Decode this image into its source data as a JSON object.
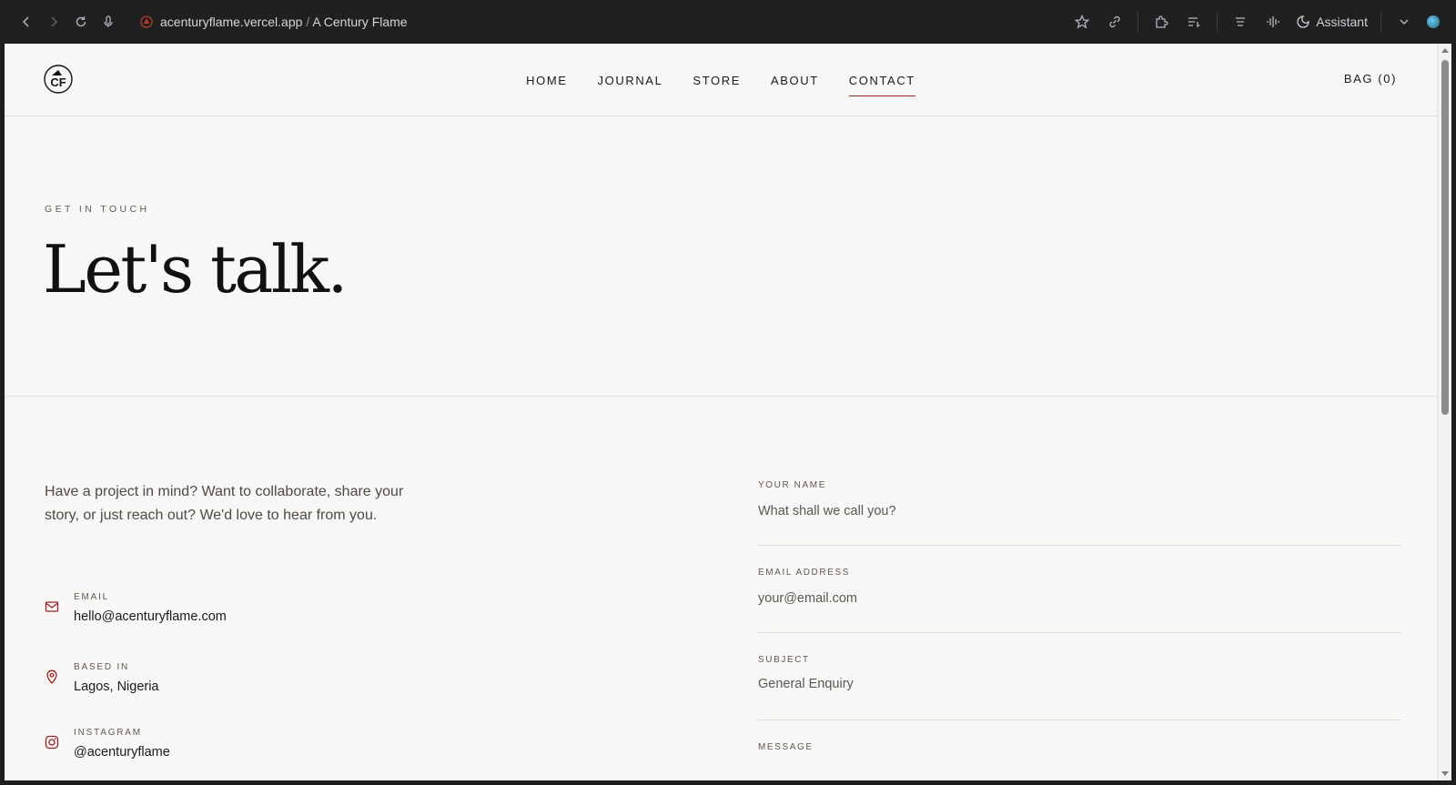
{
  "browser": {
    "url_domain": "acenturyflame.vercel.app",
    "url_separator": "/",
    "page_title": "A Century Flame",
    "assistant_label": "Assistant"
  },
  "header": {
    "logo_text": "CF",
    "nav": [
      {
        "label": "HOME",
        "active": false
      },
      {
        "label": "JOURNAL",
        "active": false
      },
      {
        "label": "STORE",
        "active": false
      },
      {
        "label": "ABOUT",
        "active": false
      },
      {
        "label": "CONTACT",
        "active": true
      }
    ],
    "bag_label": "BAG (0)"
  },
  "hero": {
    "eyebrow": "GET IN TOUCH",
    "headline": "Let's talk."
  },
  "contact": {
    "intro": "Have a project in mind? Want to collaborate, share your story, or just reach out? We'd love to hear from you.",
    "email_label": "EMAIL",
    "email_value": "hello@acenturyflame.com",
    "location_label": "BASED IN",
    "location_value": "Lagos, Nigeria",
    "instagram_label": "INSTAGRAM",
    "instagram_value": "@acenturyflame"
  },
  "form": {
    "name_label": "YOUR NAME",
    "name_placeholder": "What shall we call you?",
    "email_label": "EMAIL ADDRESS",
    "email_placeholder": "your@email.com",
    "subject_label": "SUBJECT",
    "subject_value": "General Enquiry",
    "message_label": "MESSAGE"
  },
  "colors": {
    "accent": "#9b2226",
    "page_bg": "#f8f7f5",
    "text": "#1a1a1a"
  }
}
